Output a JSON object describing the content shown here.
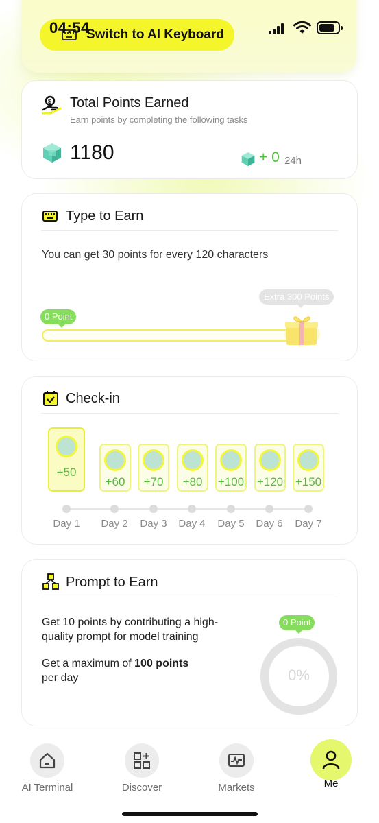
{
  "status_bar": {
    "time": "04:54",
    "keyboard_banner": "Switch to AI Keyboard"
  },
  "total_points": {
    "title": "Total Points Earned",
    "subtitle": "Earn points by completing the following tasks",
    "points": "1180",
    "delta": "+ 0",
    "period": "24h"
  },
  "type_to_earn": {
    "title": "Type to Earn",
    "description": "You can get 30 points for every 120 characters",
    "current_badge": "0 Point",
    "goal_badge": "Extra 300 Points",
    "progress_fraction": 0
  },
  "check_in": {
    "title": "Check-in",
    "days": [
      {
        "reward": "+50",
        "label": "Day 1",
        "active": true
      },
      {
        "reward": "+60",
        "label": "Day 2",
        "active": false
      },
      {
        "reward": "+70",
        "label": "Day 3",
        "active": false
      },
      {
        "reward": "+80",
        "label": "Day 4",
        "active": false
      },
      {
        "reward": "+100",
        "label": "Day 5",
        "active": false
      },
      {
        "reward": "+120",
        "label": "Day 6",
        "active": false
      },
      {
        "reward": "+150",
        "label": "Day 7",
        "active": false
      }
    ]
  },
  "prompt_to_earn": {
    "title": "Prompt to Earn",
    "line1": "Get 10 points by contributing a high-quality prompt for model training",
    "line2_prefix": "Get a maximum of ",
    "line2_bold": "100 points",
    "line2_suffix": "per day",
    "badge": "0 Point",
    "percent_label": "0%",
    "progress_fraction": 0
  },
  "bottom_nav": {
    "items": [
      {
        "label": "AI Terminal",
        "icon": "home-icon"
      },
      {
        "label": "Discover",
        "icon": "grid-plus-icon"
      },
      {
        "label": "Markets",
        "icon": "chart-pulse-icon"
      },
      {
        "label": "Me",
        "icon": "person-icon",
        "active": true
      }
    ]
  },
  "colors": {
    "accent_yellow": "#f4f52a",
    "reward_green": "#57b93f",
    "badge_green": "#86dc5c"
  }
}
